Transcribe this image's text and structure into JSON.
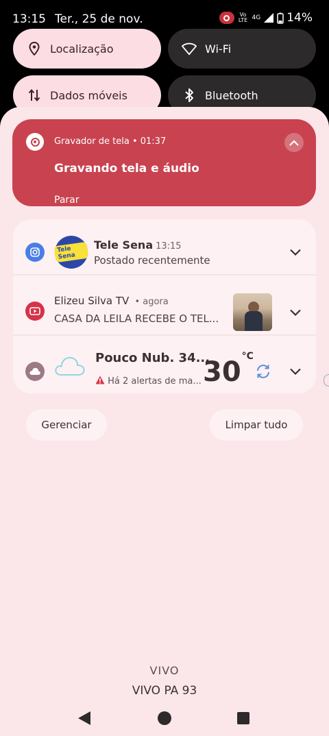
{
  "status_bar": {
    "time": "13:15",
    "date": "Ter., 25 de nov.",
    "volte": "Vo LTE",
    "network": "4G",
    "battery": "14%"
  },
  "quick_tiles": [
    {
      "label": "Localização",
      "icon": "location-pin-icon",
      "state": "on"
    },
    {
      "label": "Wi-Fi",
      "icon": "wifi-icon",
      "state": "off"
    },
    {
      "label": "Dados móveis",
      "icon": "mobile-data-icon",
      "state": "on"
    },
    {
      "label": "Bluetooth",
      "icon": "bluetooth-icon",
      "state": "off"
    }
  ],
  "screen_recorder": {
    "app": "Gravador de tela",
    "elapsed": "01:37",
    "title": "Gravando tela e áudio",
    "action": "Parar"
  },
  "notifications": [
    {
      "app_icon": "instagram-icon",
      "title": "Tele Sena",
      "time": "13:15",
      "body": "Postado recentemente",
      "avatar_text": "Tele Sena"
    },
    {
      "app_icon": "youtube-icon",
      "title": "Elizeu Silva TV",
      "time": "agora",
      "body": "CASA DA LEILA RECEBE O TEL..."
    },
    {
      "app_icon": "weather-icon",
      "title": "Pouco Nub. 34...",
      "temperature": "30",
      "unit": "°C",
      "alert": "Há 2 alertas de ma..."
    }
  ],
  "actions": {
    "manage": "Gerenciar",
    "clear_all": "Limpar tudo"
  },
  "carrier": {
    "line1": "VIVO",
    "line2": "VIVO PA 93"
  },
  "colors": {
    "recording_red": "#c8434f",
    "sheet_pink": "#fbe7ea",
    "tile_on": "#fbdde3",
    "tile_off": "#2d2a2b"
  }
}
